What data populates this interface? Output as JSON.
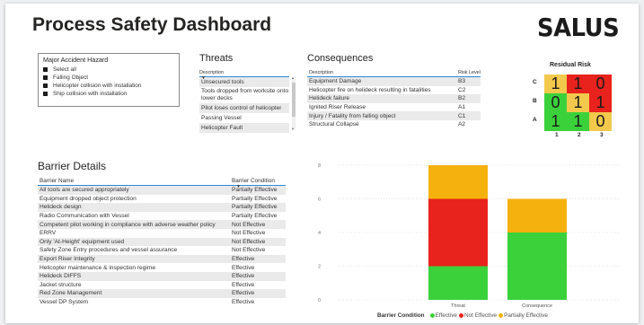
{
  "page": {
    "title": "Process Safety Dashboard",
    "logo": "SALUS"
  },
  "hazard_slicer": {
    "title": "Major Accident Hazard",
    "items": [
      "Select all",
      "Falling Object",
      "Helicopter collision with installation",
      "Ship collision with installation"
    ]
  },
  "threats": {
    "title": "Threats",
    "column": "Description",
    "rows": [
      "Unsecured tools",
      "Tools dropped from worksite onto lower decks",
      "Pilot loses control of helicopter",
      "Passing Vessel",
      "Helicopter Fault"
    ]
  },
  "consequences": {
    "title": "Consequences",
    "columns": [
      "Description",
      "Risk Level"
    ],
    "rows": [
      [
        "Equipment Damage",
        "B3"
      ],
      [
        "Helicopter fire on helideck resulting in fatalities",
        "C2"
      ],
      [
        "Helideck failure",
        "B2"
      ],
      [
        "Ignited Riser Release",
        "A1"
      ],
      [
        "Injury / Fatality from falling object",
        "C1"
      ],
      [
        "Structural Collapse",
        "A2"
      ]
    ]
  },
  "risk_matrix": {
    "title": "Residual Risk",
    "row_labels": [
      "C",
      "B",
      "A"
    ],
    "col_labels": [
      "1",
      "2",
      "3"
    ],
    "values": [
      [
        "1",
        "1",
        "0"
      ],
      [
        "0",
        "1",
        "1"
      ],
      [
        "1",
        "1",
        "0"
      ]
    ],
    "colors": [
      [
        "#f2c94c",
        "#e8221c",
        "#e8221c"
      ],
      [
        "#3bd13b",
        "#f2c94c",
        "#e8221c"
      ],
      [
        "#3bd13b",
        "#3bd13b",
        "#f2c94c"
      ]
    ]
  },
  "barriers": {
    "title": "Barrier Details",
    "columns": [
      "Barrier Name",
      "Barrier Condition"
    ],
    "rows": [
      [
        "All tools are secured appropriately",
        "Partially Effective"
      ],
      [
        "Equipment dropped object protection",
        "Partially Effective"
      ],
      [
        "Helideck design",
        "Partially Effective"
      ],
      [
        "Radio Communication with Vessel",
        "Partially Effective"
      ],
      [
        "Competent pilot working in compliance with adverse weather policy",
        "Not Effective"
      ],
      [
        "ERRV",
        "Not Effective"
      ],
      [
        "Only 'At-Height' equipment used",
        "Not Effective"
      ],
      [
        "Safety Zone Entry procedures and vessel assurance",
        "Not Effective"
      ],
      [
        "Export Riser Integrity",
        "Effective"
      ],
      [
        "Helicopter maintenance & inspection regime",
        "Effective"
      ],
      [
        "Helideck DIFFS",
        "Effective"
      ],
      [
        "Jacket structure",
        "Effective"
      ],
      [
        "Red Zone Management",
        "Effective"
      ],
      [
        "Vessel DP System",
        "Effective"
      ]
    ]
  },
  "chart_data": {
    "type": "bar",
    "stacked": true,
    "categories": [
      "Threat",
      "Consequence"
    ],
    "series": [
      {
        "name": "Effective",
        "color": "#3bd13b",
        "values": [
          2,
          4
        ]
      },
      {
        "name": "Not Effective",
        "color": "#e8221c",
        "values": [
          4,
          0
        ]
      },
      {
        "name": "Partially Effective",
        "color": "#f5b10e",
        "values": [
          2,
          2
        ]
      }
    ],
    "ylim": [
      0,
      8
    ],
    "yticks": [
      0,
      2,
      4,
      6,
      8
    ],
    "grid": true,
    "legend_title": "Barrier Condition",
    "legend_position": "bottom"
  }
}
